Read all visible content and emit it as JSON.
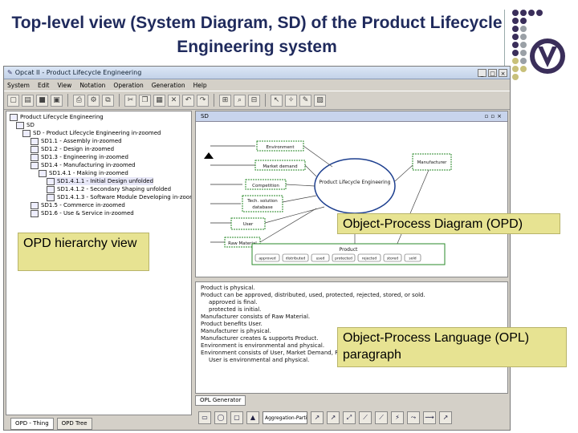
{
  "slide": {
    "title": "Top-level view (System Diagram, SD) of the Product Lifecycle Engineering system"
  },
  "window": {
    "title": "Opcat II - Product Lifecycle Engineering",
    "menus": [
      "System",
      "Edit",
      "View",
      "Notation",
      "Operation",
      "Generation",
      "Help"
    ],
    "controls": [
      "_",
      "□",
      "×"
    ]
  },
  "tree": {
    "rows": [
      {
        "label": "Product Lifecycle Engineering",
        "indent": 0
      },
      {
        "label": "SD",
        "indent": 1
      },
      {
        "label": "SD - Product Lifecycle Engineering in-zoomed",
        "indent": 2
      },
      {
        "label": "SD1.1 - Assembly in-zoomed",
        "indent": 3
      },
      {
        "label": "SD1.2 - Design in-zoomed",
        "indent": 3
      },
      {
        "label": "SD1.3 - Engineering in-zoomed",
        "indent": 3
      },
      {
        "label": "SD1.4 - Manufacturing in-zoomed",
        "indent": 3
      },
      {
        "label": "SD1.4.1 - Making in-zoomed",
        "indent": 4
      },
      {
        "label": "SD1.4.1.1 - Initial Design unfolded",
        "indent": 5
      },
      {
        "label": "SD1.4.1.2 - Secondary Shaping unfolded",
        "indent": 5
      },
      {
        "label": "SD1.4.1.3 - Software Module Developing in-zoomed",
        "indent": 5
      },
      {
        "label": "SD1.5 - Commerce in-zoomed",
        "indent": 3
      },
      {
        "label": "SD1.6 - Use & Service in-zoomed",
        "indent": 3
      }
    ],
    "tabs": [
      "OPD - Thing",
      "OPD Tree"
    ]
  },
  "diagram": {
    "tab_label": "SD",
    "objects": [
      "Environment",
      "Manufacturer",
      "Competition",
      "Tech. solution database",
      "User",
      "Raw Material"
    ],
    "main_process": "Product Lifecycle Engineering",
    "product": "Product",
    "product_states": [
      "approved",
      "distributed",
      "used",
      "protected",
      "rejected",
      "stored",
      "sold"
    ]
  },
  "opl": {
    "lines": [
      "Product is physical.",
      "Product can be approved, distributed, used, protected, rejected, stored, or sold.",
      "approved is final.",
      "protected is initial.",
      "Manufacturer consists of Raw Material.",
      "Product benefits User.",
      "Manufacturer is physical.",
      "Manufacturer creates & supports Product.",
      "Environment is environmental and physical.",
      "Environment consists of User, Market Demand, Raw Material, Technological Capabilities, and Competition.",
      "User is environmental and physical."
    ],
    "generator_tab": "OPL Generator",
    "combo_value": "Aggregation-Participation"
  },
  "callouts": {
    "opd": "Object-Process Diagram (OPD)",
    "hierarchy": "OPD hierarchy view",
    "opl": "Object-Process Language (OPL) paragraph"
  },
  "colors": {
    "title_blue": "#1f2a5c",
    "callout_bg": "#e7e392",
    "logo_dark": "#3a2e5a",
    "logo_gray": "#9aa0a6",
    "logo_olive": "#c8c07a"
  }
}
